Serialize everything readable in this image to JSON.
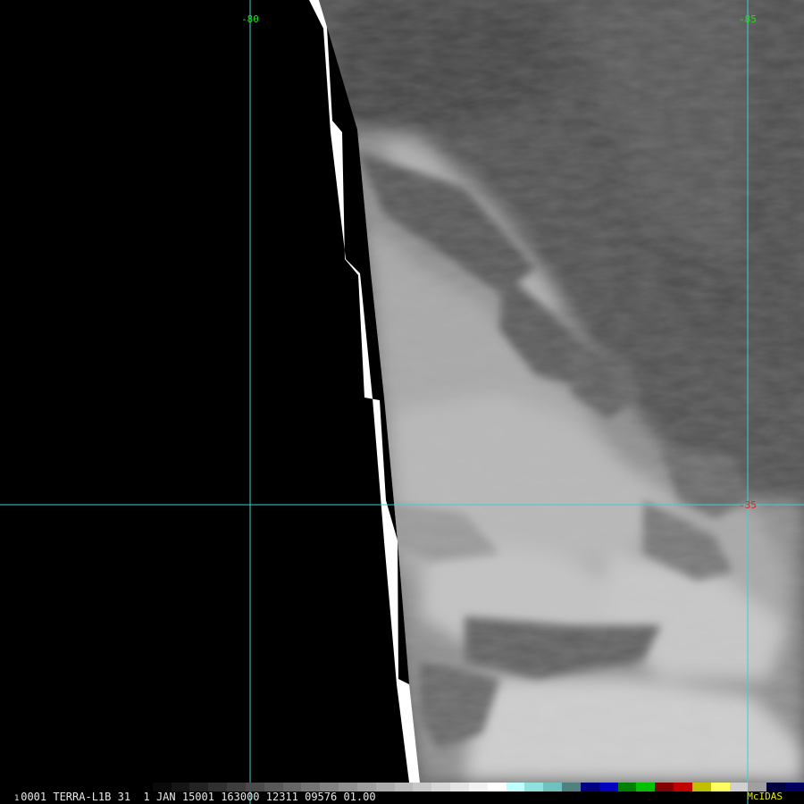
{
  "image": {
    "satellite_label": "TERRA-L1B",
    "band": "31",
    "frame": "0001",
    "date": "1 JAN 15001",
    "time": "163000",
    "field_a": "12311",
    "field_b": "09576",
    "field_c": "01.00",
    "status_line": "0001 TERRA-L1B 31  1 JAN 15001 163000 12311 09576 01.00",
    "frame_marker": "1",
    "brand": "McIDAS"
  },
  "gridlines": {
    "longitudes": [
      {
        "label": "-80",
        "color": "#22dd22"
      },
      {
        "label": "-85",
        "color": "#22dd22"
      }
    ],
    "latitudes": [
      {
        "label": "-35",
        "color": "#dd2222"
      }
    ],
    "line_color": "#40d0d0"
  },
  "colorbar": {
    "stops": [
      "#000000",
      "#0a0a0a",
      "#151515",
      "#222222",
      "#303030",
      "#3d3d3d",
      "#4a4a4a",
      "#585858",
      "#666666",
      "#747474",
      "#828282",
      "#909090",
      "#9e9e9e",
      "#acacac",
      "#bababa",
      "#c8c8c8",
      "#d6d6d6",
      "#e4e4e4",
      "#f2f2f2",
      "#ffffff",
      "#c0ffff",
      "#90e0e0",
      "#70c0c0",
      "#508080",
      "#000080",
      "#0000c0",
      "#008000",
      "#00c000",
      "#800000",
      "#c00000",
      "#c0c000",
      "#ffff60",
      "#d0d0d0",
      "#a0a0a0",
      "#000040",
      "#000060"
    ]
  },
  "colors": {
    "space": "#000000",
    "limb": "#ffffff",
    "cloud_dark": "#555555",
    "cloud_bright": "#d8d8d8"
  }
}
